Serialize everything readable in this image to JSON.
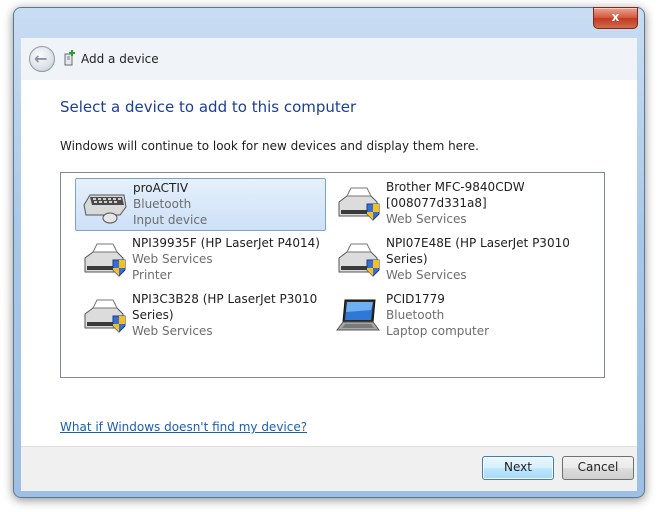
{
  "window": {
    "title": "Add a device",
    "close_label": "x"
  },
  "main": {
    "heading": "Select a device to add to this computer",
    "description": "Windows will continue to look for new devices and display them here.",
    "devices": [
      {
        "name": "proACTIV",
        "line2": "Bluetooth",
        "line3": "Input device",
        "icon": "keyboard-mouse-icon",
        "selected": true
      },
      {
        "name": "Brother MFC-9840CDW",
        "line2": "[008077d331a8]",
        "line3": "Web Services",
        "icon": "printer-icon"
      },
      {
        "name": "NPI39935F (HP LaserJet P4014)",
        "line2": "Web Services",
        "line3": "Printer",
        "icon": "printer-icon"
      },
      {
        "name": "NPI07E48E (HP LaserJet P3010",
        "line2": "Series)",
        "line3": "Web Services",
        "icon": "printer-icon"
      },
      {
        "name": "NPI3C3B28 (HP LaserJet P3010",
        "line2": "Series)",
        "line3": "Web Services",
        "icon": "printer-icon"
      },
      {
        "name": "PCID1779",
        "line2": "Bluetooth",
        "line3": "Laptop computer",
        "icon": "laptop-icon"
      }
    ],
    "help_link": "What if Windows doesn't find my device?"
  },
  "footer": {
    "next_label": "Next",
    "cancel_label": "Cancel"
  }
}
